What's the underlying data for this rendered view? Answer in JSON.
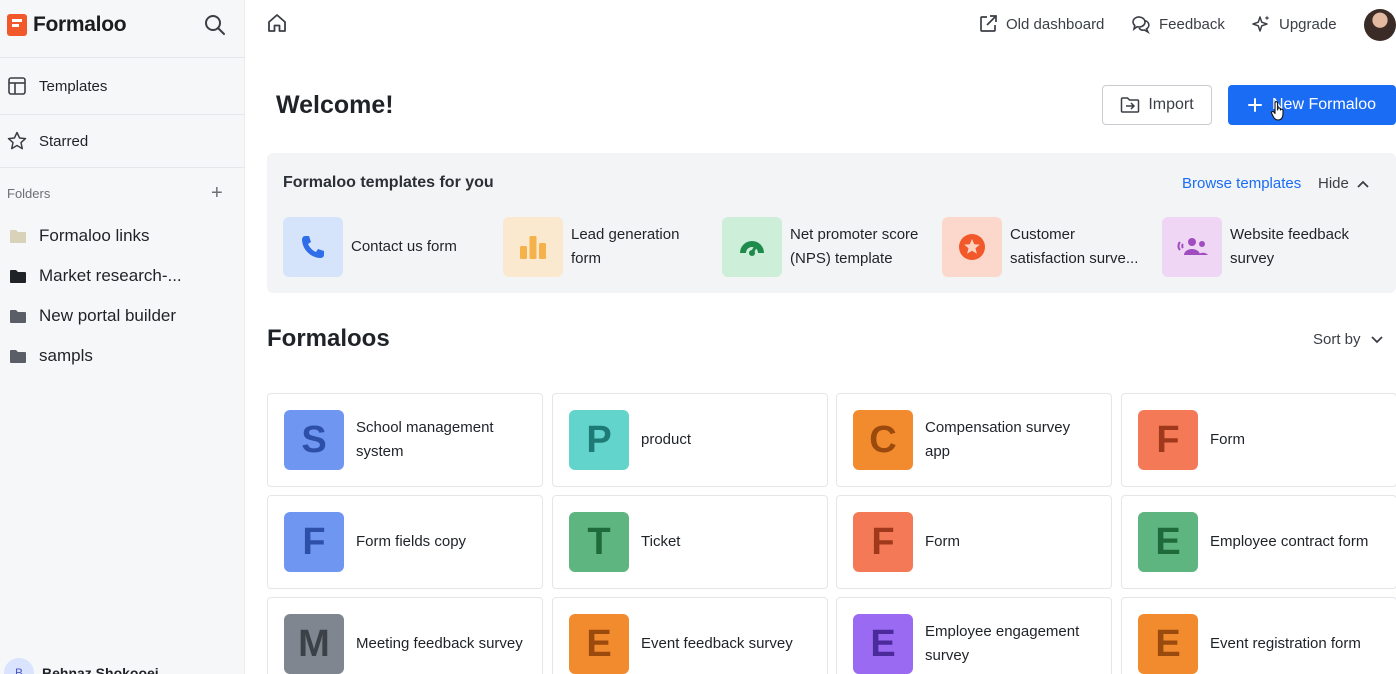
{
  "brand": {
    "name": "Formaloo"
  },
  "sidebar": {
    "nav": [
      {
        "label": "Templates",
        "icon": "templates-icon"
      },
      {
        "label": "Starred",
        "icon": "star-icon"
      }
    ],
    "folders_heading": "Folders",
    "folders": [
      {
        "label": "Formaloo links",
        "color": "#d9d2b8"
      },
      {
        "label": "Market research-...",
        "color": "#1f2328"
      },
      {
        "label": "New portal builder",
        "color": "#5a5e66"
      },
      {
        "label": "sampls",
        "color": "#5a5e66"
      }
    ],
    "user": {
      "initial": "B",
      "name": "Behnaz Shokooei"
    }
  },
  "topbar": {
    "old_dashboard": "Old dashboard",
    "feedback": "Feedback",
    "upgrade": "Upgrade"
  },
  "main": {
    "welcome": "Welcome!",
    "import_label": "Import",
    "new_label": "New Formaloo"
  },
  "templates": {
    "title": "Formaloo templates for you",
    "browse": "Browse templates",
    "hide": "Hide",
    "items": [
      {
        "label": "Contact us form",
        "icon": "phone-icon",
        "bg": "#d6e4fb"
      },
      {
        "label": "Lead generation form",
        "icon": "bar-chart-icon",
        "bg": "#fbe9cf"
      },
      {
        "label": "Net promoter score (NPS) template",
        "icon": "gauge-icon",
        "bg": "#cdeed9"
      },
      {
        "label": "Customer satisfaction surve...",
        "icon": "star-badge-icon",
        "bg": "#fbd8cb"
      },
      {
        "label": "Website feedback survey",
        "icon": "group-icon",
        "bg": "#eed6f4"
      }
    ]
  },
  "formaloos": {
    "title": "Formaloos",
    "sort_label": "Sort by",
    "items": [
      {
        "letter": "S",
        "name": "School management system",
        "bg": "#6f97f2",
        "fg": "#2d4fa8"
      },
      {
        "letter": "P",
        "name": "product",
        "bg": "#62d4cc",
        "fg": "#1e7a74"
      },
      {
        "letter": "C",
        "name": "Compensation survey app",
        "bg": "#f28a2e",
        "fg": "#9a4a0c"
      },
      {
        "letter": "F",
        "name": "Form",
        "bg": "#f47a57",
        "fg": "#a0391b"
      },
      {
        "letter": "F",
        "name": "Form fields copy",
        "bg": "#6f97f2",
        "fg": "#2d4fa8"
      },
      {
        "letter": "T",
        "name": "Ticket",
        "bg": "#5fb57f",
        "fg": "#1f6a3b"
      },
      {
        "letter": "F",
        "name": "Form",
        "bg": "#f47a57",
        "fg": "#a0391b"
      },
      {
        "letter": "E",
        "name": "Employee contract form",
        "bg": "#5fb57f",
        "fg": "#1f6a3b"
      },
      {
        "letter": "M",
        "name": "Meeting feedback survey",
        "bg": "#7f8690",
        "fg": "#3c4148"
      },
      {
        "letter": "E",
        "name": "Event feedback survey",
        "bg": "#f28a2e",
        "fg": "#9a4a0c"
      },
      {
        "letter": "E",
        "name": "Employee engagement survey",
        "bg": "#9a6af2",
        "fg": "#4b2a9c"
      },
      {
        "letter": "E",
        "name": "Event registration form",
        "bg": "#f28a2e",
        "fg": "#9a4a0c"
      }
    ]
  }
}
